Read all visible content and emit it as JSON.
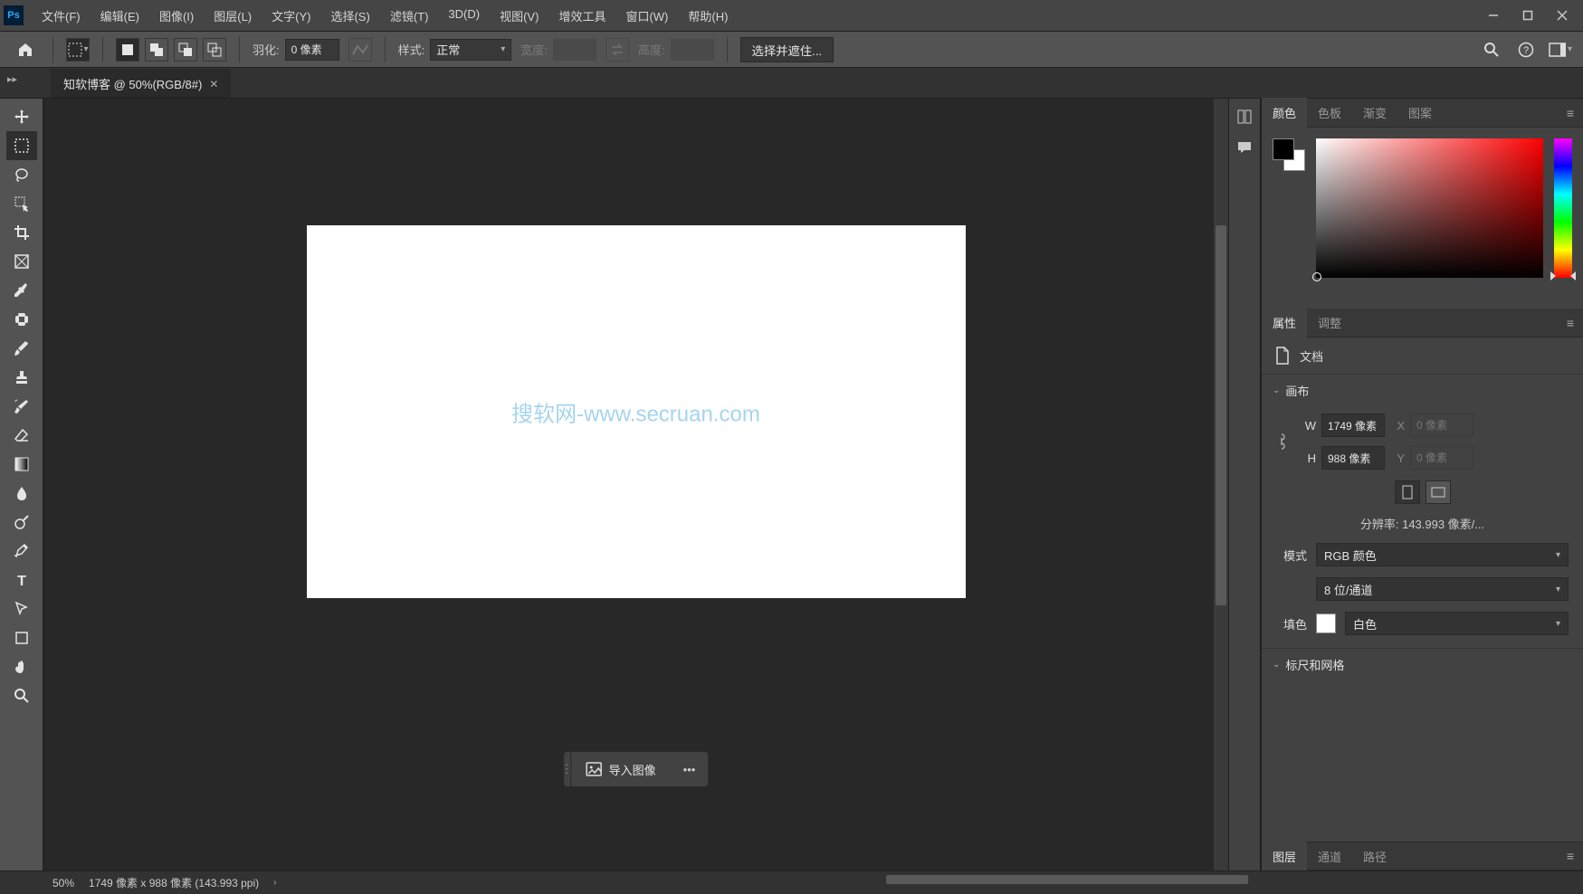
{
  "menubar": {
    "items": [
      "文件(F)",
      "编辑(E)",
      "图像(I)",
      "图层(L)",
      "文字(Y)",
      "选择(S)",
      "滤镜(T)",
      "3D(D)",
      "视图(V)",
      "增效工具",
      "窗口(W)",
      "帮助(H)"
    ]
  },
  "optionbar": {
    "feather_label": "羽化:",
    "feather_value": "0 像素",
    "style_label": "样式:",
    "style_value": "正常",
    "width_label": "宽度:",
    "height_label": "高度:",
    "mask_button": "选择并遮住..."
  },
  "tab": {
    "title": "知软博客 @ 50%(RGB/8#)"
  },
  "canvas": {
    "watermark": "搜软网-www.secruan.com",
    "import_label": "导入图像"
  },
  "color_tabs": [
    "颜色",
    "色板",
    "渐变",
    "图案"
  ],
  "props_tabs": [
    "属性",
    "调整"
  ],
  "props": {
    "doc_label": "文档",
    "canvas_section": "画布",
    "w_label": "W",
    "w_value": "1749 像素",
    "h_label": "H",
    "h_value": "988 像素",
    "x_label": "X",
    "x_placeholder": "0 像素",
    "y_label": "Y",
    "y_placeholder": "0 像素",
    "resolution": "分辨率: 143.993 像素/...",
    "mode_label": "模式",
    "mode_value": "RGB 颜色",
    "depth_value": "8 位/通道",
    "fill_label": "填色",
    "fill_value": "白色",
    "rulers_section": "标尺和网格"
  },
  "layers_tabs": [
    "图层",
    "通道",
    "路径"
  ],
  "status": {
    "zoom": "50%",
    "dims": "1749 像素 x 988 像素 (143.993 ppi)"
  }
}
